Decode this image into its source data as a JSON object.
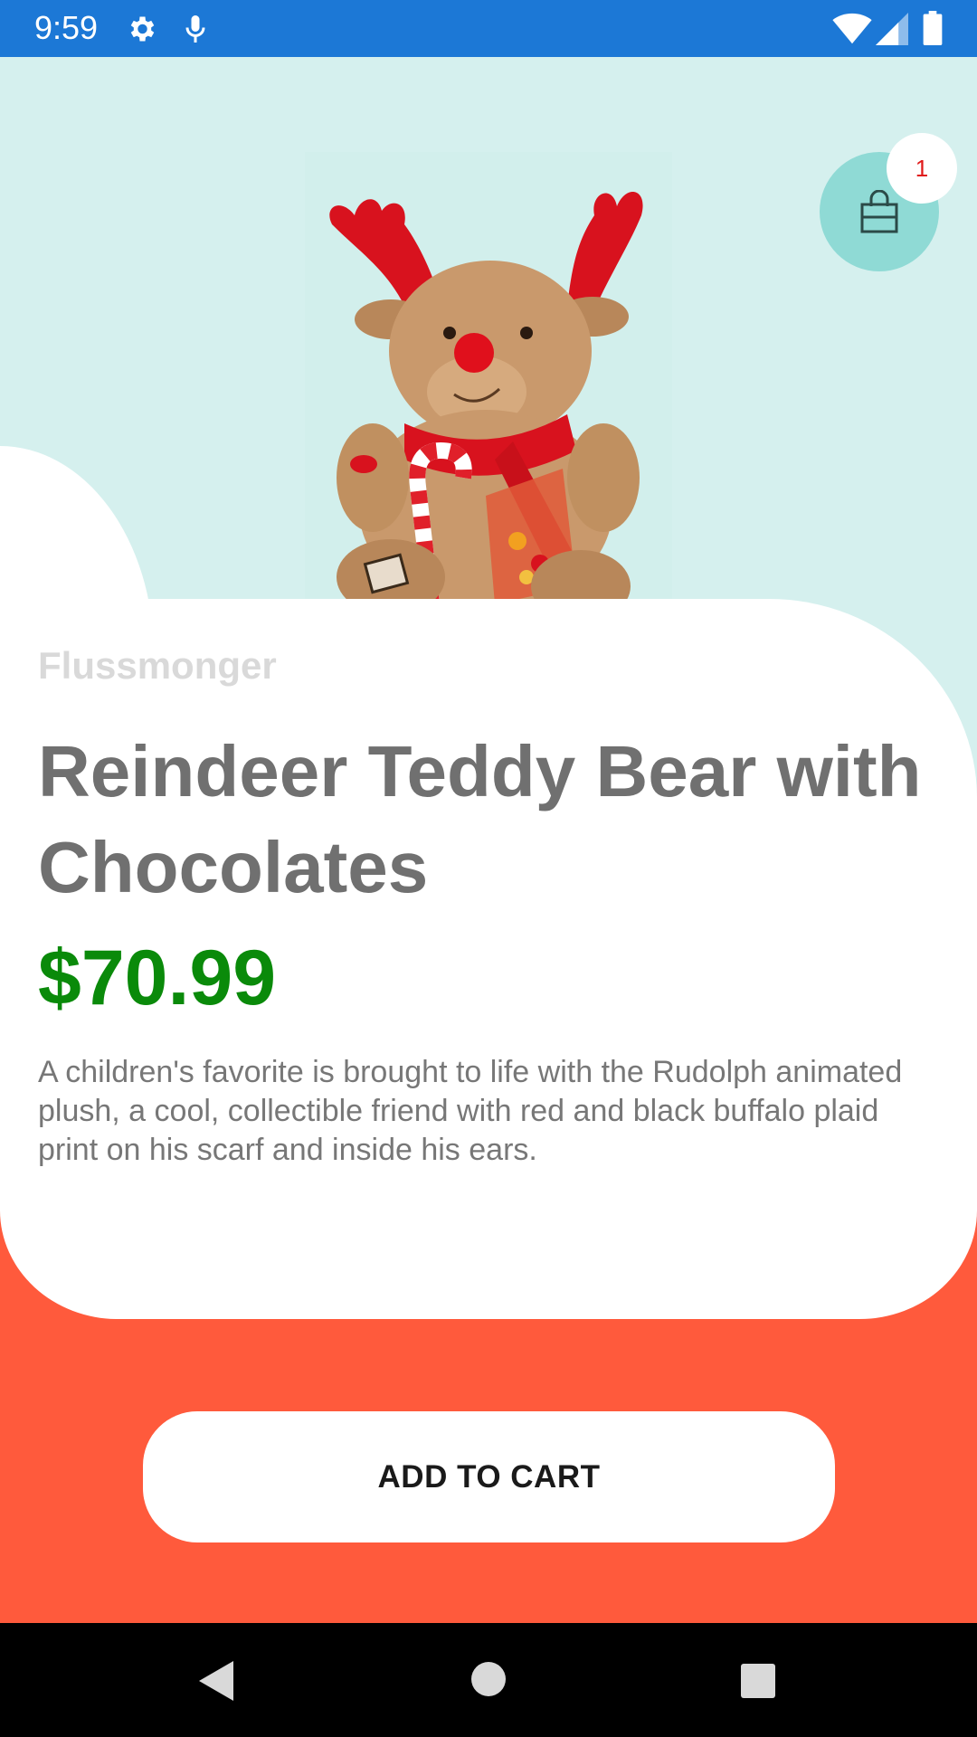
{
  "status_bar": {
    "time": "9:59",
    "icons": [
      "gear-icon",
      "mic-icon",
      "wifi-icon",
      "cell-signal-icon",
      "battery-icon"
    ]
  },
  "header": {
    "cart_badge_count": "1",
    "cart_icon": "shopping-bag-icon"
  },
  "product": {
    "brand": "Flussmonger",
    "title": "Reindeer Teddy Bear with Chocolates",
    "price": "$70.99",
    "description": "A children's favorite is brought to life with the Rudolph animated plush, a cool, collectible friend with red and black buffalo plaid print on his scarf and inside his ears."
  },
  "actions": {
    "add_to_cart_label": "ADD TO CART"
  },
  "nav_bar": {
    "icons": [
      "back-icon",
      "home-icon",
      "recents-icon"
    ]
  },
  "colors": {
    "status_bar": "#1c78d6",
    "hero_background": "#d5f0ee",
    "cart_button": "#8fdad5",
    "badge_text": "#e01a1a",
    "price": "#0a8a0a",
    "footer_background": "#ff5a3c"
  }
}
